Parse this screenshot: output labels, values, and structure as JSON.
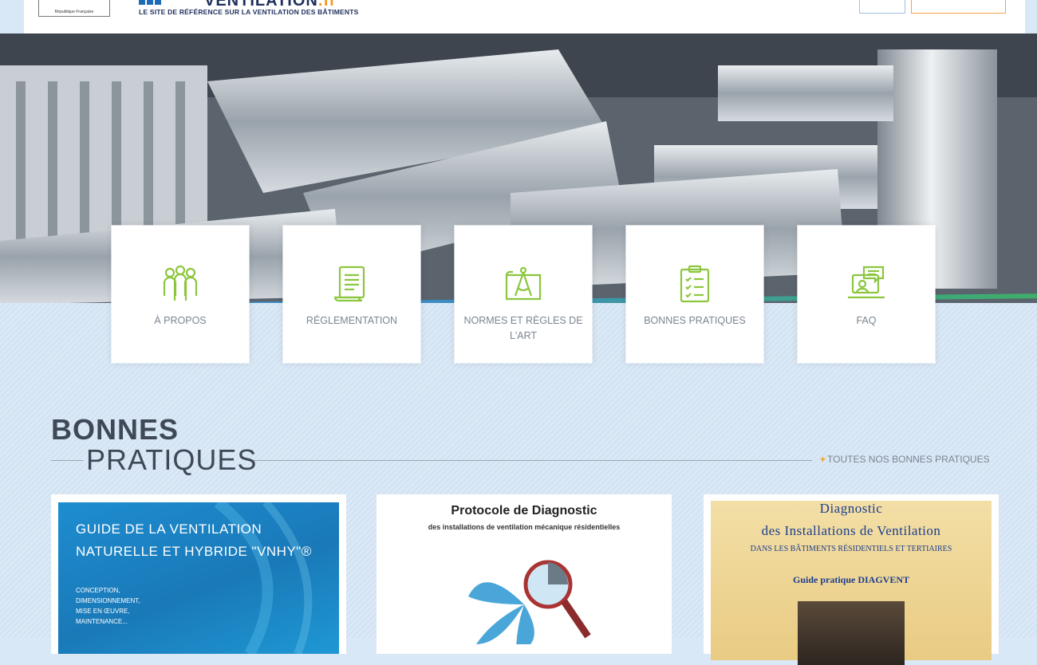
{
  "header": {
    "brand_name": "VENTILATION",
    "brand_tld": ".fr",
    "tagline": "LE SITE DE RÉFÉRENCE SUR LA VENTILATION DES BÂTIMENTS",
    "gov_logo_text": "République Française"
  },
  "nav_cards": [
    {
      "label": "À PROPOS",
      "icon": "people-icon"
    },
    {
      "label": "RÉGLEMENTATION",
      "icon": "document-scroll-icon"
    },
    {
      "label": "NORMES ET RÈGLES DE L'ART",
      "icon": "compass-blueprint-icon"
    },
    {
      "label": "BONNES PRATIQUES",
      "icon": "clipboard-checklist-icon"
    },
    {
      "label": "FAQ",
      "icon": "chat-question-icon"
    }
  ],
  "section": {
    "title_line1": "BONNES",
    "title_line2": "PRATIQUES",
    "all_link": "TOUTES NOS BONNES PRATIQUES"
  },
  "guides": {
    "g1": {
      "title_line1": "GUIDE DE LA  VENTILATION",
      "title_line2": "NATURELLE ET HYBRIDE \"VNHY\"®",
      "list": [
        "CONCEPTION,",
        "DIMENSIONNEMENT,",
        "MISE EN ŒUVRE,",
        "MAINTENANCE..."
      ]
    },
    "g2": {
      "title": "Protocole de Diagnostic",
      "subtitle": "des installations de ventilation mécanique résidentielles"
    },
    "g3": {
      "line1": "Diagnostic",
      "line2": "des Installations de Ventilation",
      "line3": "DANS LES BÂTIMENTS RÉSIDENTIELS ET TERTIAIRES",
      "line4": "Guide pratique DIAGVENT"
    }
  },
  "colors": {
    "accent_green": "#8cc63f",
    "brand_navy": "#1d2f5c",
    "brand_orange": "#f29a1f",
    "text_gray": "#7b8593"
  }
}
